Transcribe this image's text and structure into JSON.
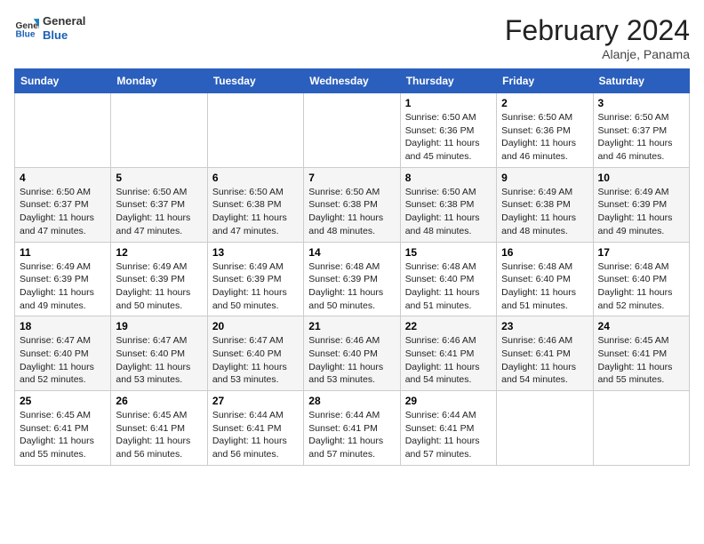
{
  "header": {
    "logo": {
      "general": "General",
      "blue": "Blue"
    },
    "title": "February 2024",
    "location": "Alanje, Panama"
  },
  "calendar": {
    "weekdays": [
      "Sunday",
      "Monday",
      "Tuesday",
      "Wednesday",
      "Thursday",
      "Friday",
      "Saturday"
    ],
    "weeks": [
      [
        {
          "day": "",
          "info": ""
        },
        {
          "day": "",
          "info": ""
        },
        {
          "day": "",
          "info": ""
        },
        {
          "day": "",
          "info": ""
        },
        {
          "day": "1",
          "info": "Sunrise: 6:50 AM\nSunset: 6:36 PM\nDaylight: 11 hours\nand 45 minutes."
        },
        {
          "day": "2",
          "info": "Sunrise: 6:50 AM\nSunset: 6:36 PM\nDaylight: 11 hours\nand 46 minutes."
        },
        {
          "day": "3",
          "info": "Sunrise: 6:50 AM\nSunset: 6:37 PM\nDaylight: 11 hours\nand 46 minutes."
        }
      ],
      [
        {
          "day": "4",
          "info": "Sunrise: 6:50 AM\nSunset: 6:37 PM\nDaylight: 11 hours\nand 47 minutes."
        },
        {
          "day": "5",
          "info": "Sunrise: 6:50 AM\nSunset: 6:37 PM\nDaylight: 11 hours\nand 47 minutes."
        },
        {
          "day": "6",
          "info": "Sunrise: 6:50 AM\nSunset: 6:38 PM\nDaylight: 11 hours\nand 47 minutes."
        },
        {
          "day": "7",
          "info": "Sunrise: 6:50 AM\nSunset: 6:38 PM\nDaylight: 11 hours\nand 48 minutes."
        },
        {
          "day": "8",
          "info": "Sunrise: 6:50 AM\nSunset: 6:38 PM\nDaylight: 11 hours\nand 48 minutes."
        },
        {
          "day": "9",
          "info": "Sunrise: 6:49 AM\nSunset: 6:38 PM\nDaylight: 11 hours\nand 48 minutes."
        },
        {
          "day": "10",
          "info": "Sunrise: 6:49 AM\nSunset: 6:39 PM\nDaylight: 11 hours\nand 49 minutes."
        }
      ],
      [
        {
          "day": "11",
          "info": "Sunrise: 6:49 AM\nSunset: 6:39 PM\nDaylight: 11 hours\nand 49 minutes."
        },
        {
          "day": "12",
          "info": "Sunrise: 6:49 AM\nSunset: 6:39 PM\nDaylight: 11 hours\nand 50 minutes."
        },
        {
          "day": "13",
          "info": "Sunrise: 6:49 AM\nSunset: 6:39 PM\nDaylight: 11 hours\nand 50 minutes."
        },
        {
          "day": "14",
          "info": "Sunrise: 6:48 AM\nSunset: 6:39 PM\nDaylight: 11 hours\nand 50 minutes."
        },
        {
          "day": "15",
          "info": "Sunrise: 6:48 AM\nSunset: 6:40 PM\nDaylight: 11 hours\nand 51 minutes."
        },
        {
          "day": "16",
          "info": "Sunrise: 6:48 AM\nSunset: 6:40 PM\nDaylight: 11 hours\nand 51 minutes."
        },
        {
          "day": "17",
          "info": "Sunrise: 6:48 AM\nSunset: 6:40 PM\nDaylight: 11 hours\nand 52 minutes."
        }
      ],
      [
        {
          "day": "18",
          "info": "Sunrise: 6:47 AM\nSunset: 6:40 PM\nDaylight: 11 hours\nand 52 minutes."
        },
        {
          "day": "19",
          "info": "Sunrise: 6:47 AM\nSunset: 6:40 PM\nDaylight: 11 hours\nand 53 minutes."
        },
        {
          "day": "20",
          "info": "Sunrise: 6:47 AM\nSunset: 6:40 PM\nDaylight: 11 hours\nand 53 minutes."
        },
        {
          "day": "21",
          "info": "Sunrise: 6:46 AM\nSunset: 6:40 PM\nDaylight: 11 hours\nand 53 minutes."
        },
        {
          "day": "22",
          "info": "Sunrise: 6:46 AM\nSunset: 6:41 PM\nDaylight: 11 hours\nand 54 minutes."
        },
        {
          "day": "23",
          "info": "Sunrise: 6:46 AM\nSunset: 6:41 PM\nDaylight: 11 hours\nand 54 minutes."
        },
        {
          "day": "24",
          "info": "Sunrise: 6:45 AM\nSunset: 6:41 PM\nDaylight: 11 hours\nand 55 minutes."
        }
      ],
      [
        {
          "day": "25",
          "info": "Sunrise: 6:45 AM\nSunset: 6:41 PM\nDaylight: 11 hours\nand 55 minutes."
        },
        {
          "day": "26",
          "info": "Sunrise: 6:45 AM\nSunset: 6:41 PM\nDaylight: 11 hours\nand 56 minutes."
        },
        {
          "day": "27",
          "info": "Sunrise: 6:44 AM\nSunset: 6:41 PM\nDaylight: 11 hours\nand 56 minutes."
        },
        {
          "day": "28",
          "info": "Sunrise: 6:44 AM\nSunset: 6:41 PM\nDaylight: 11 hours\nand 57 minutes."
        },
        {
          "day": "29",
          "info": "Sunrise: 6:44 AM\nSunset: 6:41 PM\nDaylight: 11 hours\nand 57 minutes."
        },
        {
          "day": "",
          "info": ""
        },
        {
          "day": "",
          "info": ""
        }
      ]
    ]
  }
}
